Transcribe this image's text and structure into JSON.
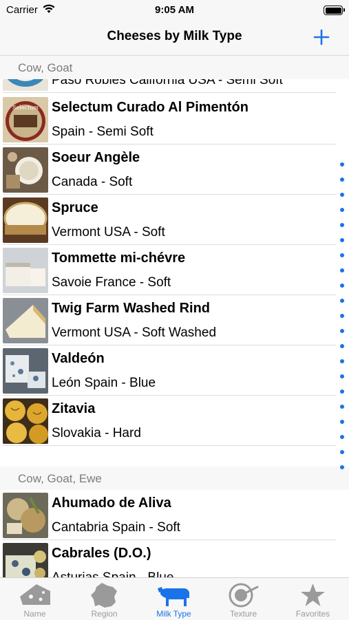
{
  "status_bar": {
    "carrier": "Carrier",
    "time": "9:05 AM"
  },
  "nav": {
    "title": "Cheeses by Milk Type",
    "add_icon": "plus-icon"
  },
  "sections": [
    {
      "title": "Cow, Goat"
    },
    {
      "title": "Cow, Goat, Ewe"
    }
  ],
  "cheeses": [
    {
      "name": "",
      "detail": "Paso Robles California USA - Semi Soft"
    },
    {
      "name": "Selectum Curado Al Pimentón",
      "detail": "Spain - Semi Soft"
    },
    {
      "name": "Soeur Angèle",
      "detail": "Canada - Soft"
    },
    {
      "name": "Spruce",
      "detail": "Vermont USA - Soft"
    },
    {
      "name": "Tommette mi-chévre",
      "detail": "Savoie France - Soft"
    },
    {
      "name": "Twig Farm Washed Rind",
      "detail": "Vermont USA - Soft Washed"
    },
    {
      "name": "Valdeón",
      "detail": "León Spain - Blue"
    },
    {
      "name": "Zitavia",
      "detail": "Slovakia - Hard"
    },
    {
      "name": "Ahumado de Aliva",
      "detail": "Cantabria Spain - Soft"
    },
    {
      "name": "Cabrales (D.O.)",
      "detail": "Asturias Spain - Blue"
    }
  ],
  "tabs": [
    {
      "label": "Name",
      "icon": "cheese-wedge-icon",
      "active": false
    },
    {
      "label": "Region",
      "icon": "france-map-icon",
      "active": false
    },
    {
      "label": "Milk Type",
      "icon": "cow-icon",
      "active": true
    },
    {
      "label": "Texture",
      "icon": "texture-icon",
      "active": false
    },
    {
      "label": "Favorites",
      "icon": "star-icon",
      "active": false
    }
  ],
  "colors": {
    "accent": "#1a73e8",
    "section_text": "#7c7c7c",
    "bar_bg": "#f7f7f7"
  }
}
